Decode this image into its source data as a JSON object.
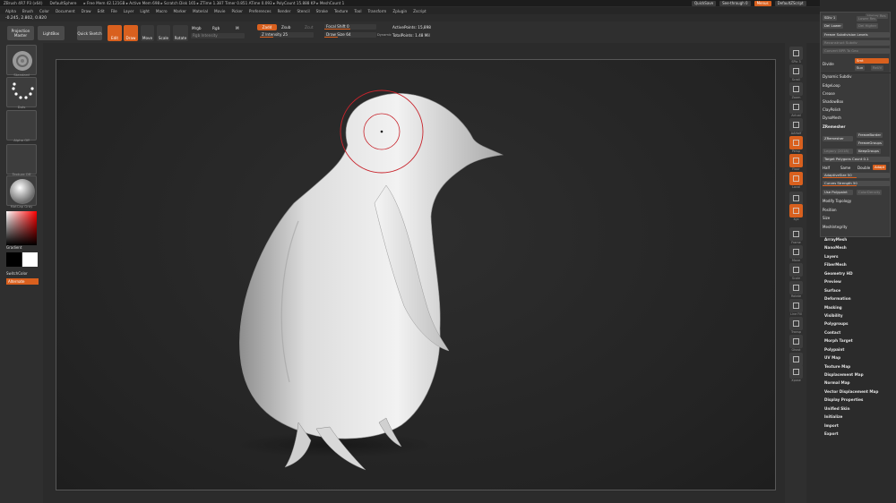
{
  "titlebar": {
    "app": "ZBrush 4R7 P3 (x64)",
    "document": "DefaultSphere",
    "stats": "▸ Free Mem 42.121GB ▸ Active Mem 698 ▸ Scratch Disk 165 ▸ ZTime 1.387 Timer 0.851 ATime 0.093 ▸ PolyCount 15.888 KP ▸ MeshCount 1",
    "quicksave": "QuickSave",
    "seethrough": "See-through 0",
    "menus_btn": "Menus",
    "script": "DefaultZScript"
  },
  "menubar": [
    "Alpha",
    "Brush",
    "Color",
    "Document",
    "Draw",
    "Edit",
    "File",
    "Layer",
    "Light",
    "Macro",
    "Marker",
    "Material",
    "Movie",
    "Picker",
    "Preferences",
    "Render",
    "Stencil",
    "Stroke",
    "Texture",
    "Tool",
    "Transform",
    "Zplugin",
    "Zscript"
  ],
  "coords": "-0.245, 2.802, 0.820",
  "topshelf": {
    "projection_master": "Projection Master",
    "lightbox": "LightBox",
    "quick_sketch": "Quick Sketch",
    "edit": "Edit",
    "draw": "Draw",
    "move": "Move",
    "scale": "Scale",
    "rotate": "Rotate",
    "rgb_intensity": "Rgb Intensity",
    "mrgb": "Mrgb",
    "rgb": "Rgb",
    "m": "M",
    "zadd": "Zadd",
    "zsub": "Zsub",
    "zcut": "Zcut",
    "z_intensity": "Z Intensity 25",
    "z_intensity_value": 25,
    "focal_shift": "Focal Shift 0",
    "focal_shift_value": 0,
    "draw_size": "Draw Size 64",
    "draw_size_value": 64,
    "dynamic": "Dynamic",
    "active_points": "ActivePoints: 15,898",
    "total_points": "TotalPoints: 1.48 Mil"
  },
  "leftshelf": {
    "thumbs": [
      "Standard",
      "Dots",
      "Alpha Off",
      "Texture Off",
      "MatCap Gray"
    ],
    "gradient": "Gradient",
    "switch_color": "SwitchColor",
    "alternate": "Alternate"
  },
  "rightshelf": {
    "icons": [
      "SPix 3",
      "Scroll",
      "Zoom",
      "Actual",
      "AAHalf",
      "Persp",
      "Floor",
      "Local",
      "L.Sym",
      "Xyz",
      "Frame",
      "Move",
      "Scale",
      "Rotate",
      "Line Fill",
      "Transp",
      "Ghost",
      "Solo",
      "Xpose"
    ]
  },
  "zpanel": {
    "lower_res": "Lower Res",
    "sdiv": "SDiv 1",
    "higher_res": "Higher Res",
    "del_lower": "Del Lower",
    "del_higher": "Del Higher",
    "freeze_subdivision_levels": "Freeze Subdivision Levels",
    "reconstruct_subdiv": "Reconstruct Subdiv",
    "convert_bpr_to_geo": "Convert BPR To Geo",
    "divide": "Divide",
    "smt": "Smt",
    "suv": "Suv",
    "reuv": "ReUV",
    "dynamic_subdiv": "Dynamic Subdiv",
    "edgeloop": "EdgeLoop",
    "crease": "Crease",
    "shadowbox": "ShadowBox",
    "claypolish": "ClayPolish",
    "dynamesh": "DynaMesh",
    "zremesher_header": "ZRemesher",
    "zremesher_btn": "ZRemesher",
    "freeze_border": "FreezeBorder",
    "freeze_groups": "FreezeGroups",
    "legacy": "Legacy (2018)",
    "keep_groups": "KeepGroups",
    "target_polygons": "Target Polygons Count 0.1",
    "half": "Half",
    "same": "Same",
    "double": "Double",
    "adapt": "Adapt",
    "adaptive_size": "AdaptiveSize 50",
    "adaptive_size_value": 50,
    "curves_strength": "Curves Strength 50",
    "curves_strength_value": 50,
    "use_polypaint": "Use Polypaint",
    "colordensity": "ColorDensity",
    "modify_topology": "Modify Topology",
    "position": "Position",
    "size": "Size",
    "mesh_integrity": "MeshIntegrity"
  },
  "toolmenu": [
    "ArrayMesh",
    "NanoMesh",
    "Layers",
    "FiberMesh",
    "Geometry HD",
    "Preview",
    "Surface",
    "Deformation",
    "Masking",
    "Visibility",
    "Polygroups",
    "Contact",
    "Morph Target",
    "Polypaint",
    "UV Map",
    "Texture Map",
    "Displacement Map",
    "Normal Map",
    "Vector Displacement Map",
    "Display Properties",
    "Unified Skin",
    "Initialize",
    "Import",
    "Export"
  ],
  "colors": {
    "accent": "#d9601e",
    "bg": "#2b2b2b",
    "panel": "#3a3a3a",
    "brush_ring": "#c8242c"
  }
}
